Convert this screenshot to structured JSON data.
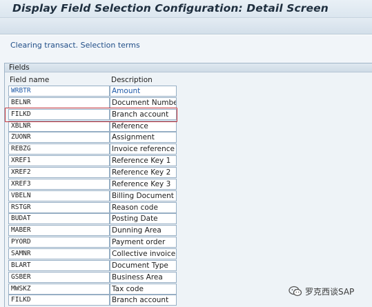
{
  "window": {
    "title": "Display Field Selection Configuration: Detail Screen"
  },
  "section": {
    "link_text": "Clearing transact. Selection terms"
  },
  "fields_group": {
    "title": "Fields",
    "columns": {
      "field_name": "Field name",
      "description": "Description"
    },
    "rows": [
      {
        "name": "WRBTR",
        "description": "Amount"
      },
      {
        "name": "BELNR",
        "description": "Document Number"
      },
      {
        "name": "FILKD",
        "description": "Branch account"
      },
      {
        "name": "XBLNR",
        "description": "Reference"
      },
      {
        "name": "ZUONR",
        "description": "Assignment"
      },
      {
        "name": "REBZG",
        "description": "Invoice reference"
      },
      {
        "name": "XREF1",
        "description": "Reference Key 1"
      },
      {
        "name": "XREF2",
        "description": "Reference Key 2"
      },
      {
        "name": "XREF3",
        "description": "Reference Key 3"
      },
      {
        "name": "VBELN",
        "description": "Billing Document"
      },
      {
        "name": "RSTGR",
        "description": "Reason code"
      },
      {
        "name": "BUDAT",
        "description": "Posting Date"
      },
      {
        "name": "MABER",
        "description": "Dunning Area"
      },
      {
        "name": "PYORD",
        "description": "Payment order"
      },
      {
        "name": "SAMNR",
        "description": "Collective invoice"
      },
      {
        "name": "BLART",
        "description": "Document Type"
      },
      {
        "name": "GSBER",
        "description": "Business Area"
      },
      {
        "name": "MWSKZ",
        "description": "Tax code"
      },
      {
        "name": "FILKD",
        "description": "Branch account"
      }
    ]
  },
  "watermark": {
    "text": "罗克西谈SAP",
    "icon": "wechat-icon"
  },
  "colors": {
    "highlight": "#c9373d",
    "link": "#1f4d87",
    "first_row_text": "#1f5aa8"
  }
}
